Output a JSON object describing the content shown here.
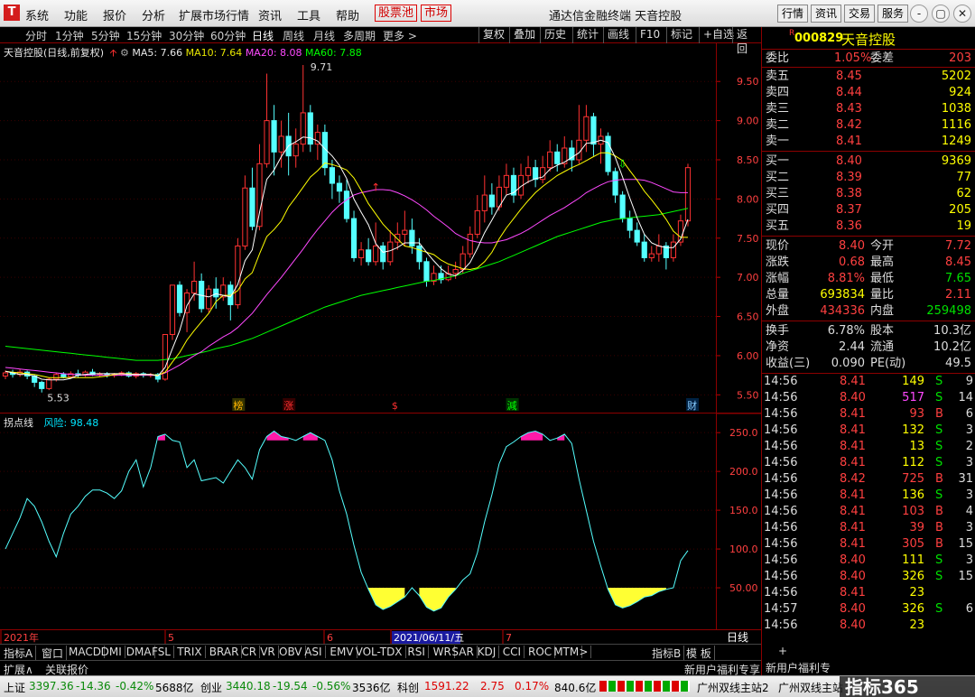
{
  "app": {
    "logo": "T",
    "menu": [
      "系统",
      "功能",
      "报价",
      "分析",
      "扩展市场行情",
      "资讯",
      "工具",
      "帮助"
    ],
    "menu_red": [
      "股票池",
      "市场"
    ],
    "title": "通达信金融终端  天音控股",
    "right_buttons": [
      "行情",
      "资讯",
      "交易",
      "服务"
    ],
    "window_controls": [
      "-",
      "▢",
      "✕"
    ]
  },
  "periods": [
    "分时",
    "1分钟",
    "5分钟",
    "15分钟",
    "30分钟",
    "60分钟",
    "日线",
    "周线",
    "月线",
    "多周期",
    "更多 >"
  ],
  "toolbar": [
    "复权",
    "叠加",
    "历史",
    "统计",
    "画线",
    "F10",
    "标记",
    "+自选",
    "返回"
  ],
  "chart_info": {
    "name": "天音控股(日线,前复权)",
    "ma5_label": "MA5: 7.66",
    "ma10_label": "MA10: 7.64",
    "ma20_label": "MA20: 8.08",
    "ma60_label": "MA60: 7.88",
    "colors": {
      "ma5": "#ffffff",
      "ma10": "#ffff00",
      "ma20": "#ff49ff",
      "ma60": "#00ff00"
    }
  },
  "sub_info": {
    "name": "拐点线",
    "value_label": "风险: 98.48"
  },
  "chart_data": {
    "type": "candlestick",
    "price_ticks": [
      "9.50",
      "9.00",
      "8.50",
      "8.00",
      "7.50",
      "7.00",
      "6.50",
      "6.00",
      "5.50"
    ],
    "sub_ticks": [
      "250.0",
      "200.0",
      "150.0",
      "100.0",
      "50.00"
    ],
    "high_label": "9.71",
    "low_label": "5.53",
    "date_labels": [
      "2021年",
      "5",
      "6",
      "2021/06/11/五",
      "7"
    ],
    "markers": [
      "榜",
      "涨",
      "$",
      "減",
      "财"
    ],
    "candles": [
      [
        5.74,
        5.78,
        5.81,
        5.7
      ],
      [
        5.78,
        5.76,
        5.82,
        5.72
      ],
      [
        5.76,
        5.79,
        5.83,
        5.73
      ],
      [
        5.79,
        5.74,
        5.81,
        5.7
      ],
      [
        5.74,
        5.66,
        5.76,
        5.6
      ],
      [
        5.66,
        5.58,
        5.68,
        5.53
      ],
      [
        5.58,
        5.7,
        5.72,
        5.56
      ],
      [
        5.7,
        5.76,
        5.78,
        5.67
      ],
      [
        5.76,
        5.73,
        5.79,
        5.71
      ],
      [
        5.73,
        5.77,
        5.8,
        5.71
      ],
      [
        5.77,
        5.75,
        5.82,
        5.72
      ],
      [
        5.75,
        5.79,
        5.81,
        5.73
      ],
      [
        5.79,
        5.76,
        5.83,
        5.74
      ],
      [
        5.76,
        5.77,
        5.79,
        5.73
      ],
      [
        5.77,
        5.75,
        5.79,
        5.72
      ],
      [
        5.75,
        5.76,
        5.78,
        5.72
      ],
      [
        5.76,
        5.78,
        5.8,
        5.74
      ],
      [
        5.78,
        5.74,
        5.8,
        5.72
      ],
      [
        5.74,
        5.77,
        5.79,
        5.71
      ],
      [
        5.77,
        5.75,
        5.79,
        5.72
      ],
      [
        5.75,
        5.76,
        5.78,
        5.72
      ],
      [
        5.76,
        5.7,
        5.78,
        5.66
      ],
      [
        5.7,
        6.27,
        6.27,
        5.68
      ],
      [
        6.27,
        6.9,
        6.9,
        6.2
      ],
      [
        6.9,
        6.55,
        6.95,
        6.5
      ],
      [
        6.55,
        6.8,
        6.85,
        6.3
      ],
      [
        6.8,
        6.95,
        7.2,
        6.7
      ],
      [
        6.95,
        6.6,
        7.05,
        6.55
      ],
      [
        6.6,
        6.85,
        6.9,
        6.55
      ],
      [
        6.85,
        6.75,
        7.0,
        6.6
      ],
      [
        6.75,
        6.9,
        7.0,
        6.7
      ],
      [
        6.9,
        6.65,
        6.95,
        6.45
      ],
      [
        6.65,
        7.4,
        7.5,
        6.6
      ],
      [
        7.4,
        8.14,
        8.3,
        7.35
      ],
      [
        8.14,
        7.65,
        8.4,
        7.6
      ],
      [
        7.65,
        8.45,
        8.7,
        7.6
      ],
      [
        8.45,
        9.0,
        9.6,
        8.4
      ],
      [
        9.0,
        8.6,
        9.2,
        8.3
      ],
      [
        8.6,
        8.8,
        9.0,
        8.4
      ],
      [
        8.8,
        8.55,
        9.1,
        8.3
      ],
      [
        8.55,
        8.7,
        8.9,
        8.4
      ],
      [
        8.7,
        9.1,
        9.71,
        8.6
      ],
      [
        9.1,
        8.7,
        9.2,
        8.6
      ],
      [
        8.7,
        8.85,
        8.95,
        8.5
      ],
      [
        8.85,
        8.4,
        8.95,
        8.3
      ],
      [
        8.4,
        8.2,
        8.5,
        8.0
      ],
      [
        8.2,
        8.1,
        8.3,
        7.95
      ],
      [
        8.1,
        7.75,
        8.25,
        7.7
      ],
      [
        7.75,
        7.25,
        7.85,
        7.2
      ],
      [
        7.25,
        7.35,
        7.45,
        7.15
      ],
      [
        7.35,
        7.2,
        7.5,
        7.15
      ],
      [
        7.2,
        7.4,
        7.7,
        7.15
      ],
      [
        7.4,
        7.2,
        7.45,
        7.1
      ],
      [
        7.2,
        7.45,
        7.6,
        7.15
      ],
      [
        7.45,
        7.55,
        7.7,
        7.35
      ],
      [
        7.55,
        7.6,
        7.85,
        7.4
      ],
      [
        7.6,
        7.4,
        7.75,
        7.3
      ],
      [
        7.4,
        7.2,
        7.5,
        7.1
      ],
      [
        7.2,
        6.95,
        7.25,
        6.88
      ],
      [
        6.95,
        7.05,
        7.15,
        6.9
      ],
      [
        7.05,
        6.97,
        7.15,
        6.92
      ],
      [
        6.97,
        7.05,
        7.15,
        6.95
      ],
      [
        7.05,
        7.1,
        7.2,
        6.98
      ],
      [
        7.1,
        7.3,
        7.4,
        7.05
      ],
      [
        7.3,
        7.55,
        7.65,
        7.25
      ],
      [
        7.55,
        7.85,
        8.05,
        7.5
      ],
      [
        7.85,
        8.05,
        8.3,
        7.7
      ],
      [
        8.05,
        7.9,
        8.2,
        7.8
      ],
      [
        7.9,
        8.15,
        8.3,
        7.85
      ],
      [
        8.15,
        8.3,
        8.45,
        8.05
      ],
      [
        8.3,
        8.05,
        8.4,
        7.95
      ],
      [
        8.05,
        8.3,
        8.45,
        8.0
      ],
      [
        8.3,
        8.4,
        8.55,
        8.2
      ],
      [
        8.4,
        8.25,
        8.5,
        8.15
      ],
      [
        8.25,
        8.4,
        8.55,
        8.2
      ],
      [
        8.4,
        8.6,
        8.75,
        8.35
      ],
      [
        8.6,
        8.45,
        8.7,
        8.35
      ],
      [
        8.45,
        8.65,
        8.8,
        8.4
      ],
      [
        8.65,
        8.5,
        8.75,
        8.35
      ],
      [
        8.5,
        8.75,
        9.2,
        8.45
      ],
      [
        8.75,
        9.05,
        9.2,
        8.6
      ],
      [
        9.05,
        8.7,
        9.1,
        8.55
      ],
      [
        8.7,
        8.8,
        8.9,
        8.45
      ],
      [
        8.8,
        8.35,
        8.85,
        8.3
      ],
      [
        8.35,
        8.05,
        8.4,
        7.95
      ],
      [
        8.05,
        7.75,
        8.1,
        7.7
      ],
      [
        7.75,
        7.6,
        7.85,
        7.5
      ],
      [
        7.6,
        7.45,
        7.7,
        7.4
      ],
      [
        7.45,
        7.25,
        7.55,
        7.2
      ],
      [
        7.25,
        7.3,
        7.4,
        7.2
      ],
      [
        7.3,
        7.4,
        7.55,
        7.2
      ],
      [
        7.4,
        7.25,
        7.45,
        7.1
      ],
      [
        7.25,
        7.45,
        7.55,
        7.2
      ],
      [
        7.45,
        7.72,
        7.8,
        7.4
      ],
      [
        7.72,
        8.4,
        8.45,
        7.65
      ]
    ],
    "ma5": [
      5.8,
      5.78,
      5.76,
      5.76,
      5.74,
      5.7,
      5.69,
      5.69,
      5.69,
      5.71,
      5.75,
      5.76,
      5.77,
      5.77,
      5.77,
      5.77,
      5.77,
      5.76,
      5.76,
      5.76,
      5.76,
      5.74,
      5.85,
      6.09,
      6.32,
      6.64,
      6.79,
      6.77,
      6.75,
      6.79,
      6.77,
      6.75,
      6.91,
      7.21,
      7.35,
      7.83,
      8.25,
      8.37,
      8.54,
      8.68,
      8.73,
      8.79,
      8.78,
      8.74,
      8.64,
      8.55,
      8.43,
      8.26,
      8.0,
      7.83,
      7.67,
      7.43,
      7.32,
      7.34,
      7.38,
      7.44,
      7.44,
      7.44,
      7.32,
      7.21,
      7.11,
      7.04,
      7.02,
      7.09,
      7.19,
      7.37,
      7.57,
      7.73,
      7.9,
      8.05,
      8.08,
      8.16,
      8.22,
      8.26,
      8.28,
      8.38,
      8.43,
      8.47,
      8.53,
      8.59,
      8.71,
      8.72,
      8.75,
      8.72,
      8.53,
      8.28,
      8.01,
      7.76,
      7.55,
      7.44,
      7.4,
      7.38,
      7.38,
      7.49,
      7.74
    ],
    "ma10": [
      5.8,
      5.79,
      5.78,
      5.77,
      5.76,
      5.74,
      5.72,
      5.72,
      5.72,
      5.72,
      5.72,
      5.72,
      5.72,
      5.73,
      5.74,
      5.76,
      5.77,
      5.77,
      5.76,
      5.76,
      5.76,
      5.75,
      5.79,
      5.92,
      6.04,
      6.2,
      6.32,
      6.43,
      6.54,
      6.69,
      6.77,
      6.77,
      6.83,
      6.98,
      7.06,
      7.3,
      7.52,
      7.61,
      7.72,
      7.9,
      8.02,
      8.15,
      8.28,
      8.36,
      8.46,
      8.44,
      8.41,
      8.37,
      8.27,
      8.11,
      7.94,
      7.81,
      7.68,
      7.58,
      7.49,
      7.4,
      7.38,
      7.35,
      7.32,
      7.29,
      7.22,
      7.17,
      7.14,
      7.11,
      7.1,
      7.12,
      7.2,
      7.32,
      7.49,
      7.63,
      7.75,
      7.87,
      7.98,
      8.08,
      8.16,
      8.23,
      8.3,
      8.35,
      8.4,
      8.44,
      8.49,
      8.54,
      8.59,
      8.59,
      8.55,
      8.49,
      8.36,
      8.24,
      8.1,
      7.99,
      7.87,
      7.74,
      7.59,
      7.51,
      7.51
    ],
    "ma20": [
      5.85,
      5.84,
      5.83,
      5.82,
      5.81,
      5.8,
      5.79,
      5.78,
      5.77,
      5.76,
      5.76,
      5.75,
      5.75,
      5.75,
      5.75,
      5.75,
      5.75,
      5.75,
      5.75,
      5.75,
      5.75,
      5.75,
      5.78,
      5.83,
      5.88,
      5.94,
      6.0,
      6.05,
      6.12,
      6.18,
      6.24,
      6.29,
      6.36,
      6.45,
      6.54,
      6.66,
      6.78,
      6.89,
      7.0,
      7.12,
      7.24,
      7.36,
      7.49,
      7.61,
      7.72,
      7.83,
      7.92,
      7.99,
      8.05,
      8.08,
      8.1,
      8.12,
      8.12,
      8.11,
      8.08,
      8.04,
      7.99,
      7.93,
      7.86,
      7.78,
      7.71,
      7.64,
      7.56,
      7.51,
      7.47,
      7.45,
      7.44,
      7.44,
      7.46,
      7.48,
      7.52,
      7.56,
      7.61,
      7.67,
      7.73,
      7.79,
      7.84,
      7.89,
      7.95,
      8.01,
      8.08,
      8.13,
      8.18,
      8.22,
      8.24,
      8.25,
      8.25,
      8.25,
      8.24,
      8.21,
      8.17,
      8.13,
      8.09,
      8.08,
      8.08
    ],
    "ma60": [
      6.12,
      6.11,
      6.1,
      6.09,
      6.08,
      6.07,
      6.06,
      6.05,
      6.04,
      6.03,
      6.02,
      6.01,
      6.0,
      5.99,
      5.98,
      5.97,
      5.96,
      5.95,
      5.94,
      5.94,
      5.94,
      5.94,
      5.95,
      5.96,
      5.98,
      6.0,
      6.02,
      6.04,
      6.06,
      6.09,
      6.11,
      6.13,
      6.16,
      6.19,
      6.22,
      6.26,
      6.3,
      6.34,
      6.38,
      6.42,
      6.46,
      6.5,
      6.54,
      6.58,
      6.62,
      6.65,
      6.68,
      6.71,
      6.74,
      6.77,
      6.79,
      6.81,
      6.83,
      6.85,
      6.87,
      6.89,
      6.91,
      6.93,
      6.95,
      6.96,
      6.98,
      7.0,
      7.02,
      7.05,
      7.08,
      7.11,
      7.14,
      7.17,
      7.2,
      7.24,
      7.28,
      7.32,
      7.36,
      7.4,
      7.44,
      7.48,
      7.52,
      7.55,
      7.58,
      7.61,
      7.64,
      7.67,
      7.7,
      7.72,
      7.74,
      7.75,
      7.76,
      7.77,
      7.78,
      7.79,
      7.8,
      7.82,
      7.84,
      7.86,
      7.88
    ],
    "sub": [
      100,
      120,
      140,
      165,
      155,
      135,
      110,
      90,
      120,
      145,
      155,
      168,
      176,
      176,
      172,
      165,
      175,
      200,
      215,
      180,
      205,
      245,
      248,
      240,
      238,
      205,
      215,
      188,
      190,
      192,
      185,
      200,
      215,
      205,
      190,
      228,
      245,
      252,
      245,
      243,
      240,
      245,
      250,
      245,
      240,
      215,
      175,
      145,
      105,
      70,
      48,
      28,
      22,
      26,
      32,
      38,
      50,
      40,
      25,
      20,
      24,
      38,
      48,
      60,
      68,
      95,
      135,
      170,
      210,
      232,
      238,
      245,
      250,
      252,
      248,
      240,
      243,
      248,
      236,
      190,
      150,
      110,
      78,
      48,
      28,
      24,
      27,
      32,
      38,
      40,
      45,
      48,
      50,
      85,
      98
    ]
  },
  "quote": {
    "code": "000829",
    "name": "天音控股",
    "r_flag": "R",
    "weibi": [
      "委比",
      "1.05%",
      "委差",
      "203"
    ],
    "sell": [
      [
        "卖五",
        "8.45",
        "5202"
      ],
      [
        "卖四",
        "8.44",
        "924"
      ],
      [
        "卖三",
        "8.43",
        "1038"
      ],
      [
        "卖二",
        "8.42",
        "1116"
      ],
      [
        "卖一",
        "8.41",
        "1249"
      ]
    ],
    "buy": [
      [
        "买一",
        "8.40",
        "9369"
      ],
      [
        "买二",
        "8.39",
        "77"
      ],
      [
        "买三",
        "8.38",
        "62"
      ],
      [
        "买四",
        "8.37",
        "205"
      ],
      [
        "买五",
        "8.36",
        "19"
      ]
    ],
    "stats": [
      [
        "现价",
        "8.40",
        "今开",
        "7.72"
      ],
      [
        "涨跌",
        "0.68",
        "最高",
        "8.45"
      ],
      [
        "涨幅",
        "8.81%",
        "最低",
        "7.65"
      ],
      [
        "总量",
        "693834",
        "量比",
        "2.11"
      ],
      [
        "外盘",
        "434336",
        "内盘",
        "259498"
      ]
    ],
    "stats2": [
      [
        "换手",
        "6.78%",
        "股本",
        "10.3亿"
      ],
      [
        "净资",
        "2.44",
        "流通",
        "10.2亿"
      ],
      [
        "收益(三)",
        "0.090",
        "PE(动)",
        "49.5"
      ]
    ],
    "ticks": [
      [
        "14:56",
        "8.41",
        "149",
        "S",
        "9"
      ],
      [
        "14:56",
        "8.40",
        "517",
        "S",
        "14"
      ],
      [
        "14:56",
        "8.41",
        "93",
        "B",
        "6"
      ],
      [
        "14:56",
        "8.41",
        "132",
        "S",
        "3"
      ],
      [
        "14:56",
        "8.41",
        "13",
        "S",
        "2"
      ],
      [
        "14:56",
        "8.41",
        "112",
        "S",
        "3"
      ],
      [
        "14:56",
        "8.42",
        "725",
        "B",
        "31"
      ],
      [
        "14:56",
        "8.41",
        "136",
        "S",
        "3"
      ],
      [
        "14:56",
        "8.41",
        "103",
        "B",
        "4"
      ],
      [
        "14:56",
        "8.41",
        "39",
        "B",
        "3"
      ],
      [
        "14:56",
        "8.41",
        "305",
        "B",
        "15"
      ],
      [
        "14:56",
        "8.40",
        "111",
        "S",
        "3"
      ],
      [
        "14:56",
        "8.40",
        "326",
        "S",
        "15"
      ],
      [
        "14:56",
        "8.41",
        "23",
        "",
        ""
      ],
      [
        "14:57",
        "8.40",
        "326",
        "S",
        "6"
      ],
      [
        "14:56",
        "8.40",
        "23",
        "",
        ""
      ]
    ]
  },
  "bottom_tabs": [
    "指标A",
    "窗口",
    "MACD",
    "DMI",
    "DMA",
    "FSL",
    "TRIX",
    "BRAR",
    "CR",
    "VR",
    "OBV",
    "ASI",
    "EMV",
    "VOL-TDX",
    "RSI",
    "WR",
    "SAR",
    "KDJ",
    "CCI",
    "ROC",
    "MTM",
    ">"
  ],
  "bottom_right": [
    "指标B",
    "模",
    "板"
  ],
  "row2": [
    "扩展∧",
    "关联报价"
  ],
  "row2_right": [
    "新用户福利专享",
    "新用户福利专",
    "+"
  ],
  "date_right": "日线",
  "status": {
    "sh_label": "上证",
    "sh_val": "3397.36",
    "sh_chg": "-14.36",
    "sh_pct": "-0.42%",
    "sh_amt": "5688亿",
    "cy_label": "创业",
    "cy_val": "3440.18",
    "cy_chg": "-19.54",
    "cy_pct": "-0.56%",
    "cy_amt": "3536亿",
    "kc_label": "科创",
    "kc_val": "1591.22",
    "kc_chg": "2.75",
    "kc_pct": "0.17%",
    "kc_amt": "840.6亿",
    "site": "广州双线主站2",
    "site2": "广州双线主站",
    "brand": "指标365"
  }
}
